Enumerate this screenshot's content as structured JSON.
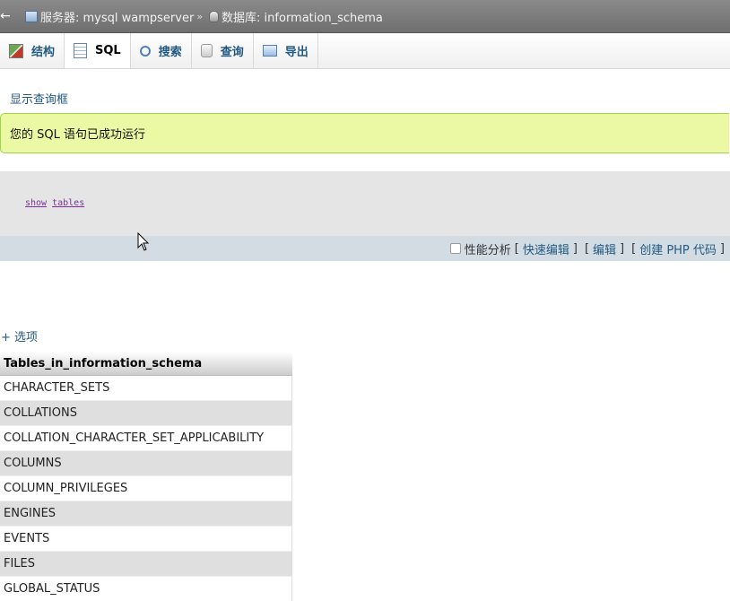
{
  "breadcrumb": {
    "back_glyph": "←",
    "server": "服务器: mysql wampserver",
    "separator": "»",
    "database": "数据库: information_schema"
  },
  "tabs": [
    {
      "label": "结构",
      "icon": "structure-icon"
    },
    {
      "label": "SQL",
      "icon": "sql-icon",
      "active": true
    },
    {
      "label": "搜索",
      "icon": "search-icon"
    },
    {
      "label": "查询",
      "icon": "query-icon"
    },
    {
      "label": "导出",
      "icon": "export-icon"
    }
  ],
  "show_query_box": "显示查询框",
  "success_message": "您的 SQL 语句已成功运行",
  "sql": {
    "keyword1": "show",
    "keyword2": "tables"
  },
  "tools": {
    "profiling": "性能分析",
    "open": "[",
    "close": "]",
    "inline_edit": "快速编辑",
    "edit": "编辑",
    "create_php": "创建 PHP 代码"
  },
  "options_link": "+ 选项",
  "results": {
    "header": "Tables_in_information_schema",
    "rows": [
      "CHARACTER_SETS",
      "COLLATIONS",
      "COLLATION_CHARACTER_SET_APPLICABILITY",
      "COLUMNS",
      "COLUMN_PRIVILEGES",
      "ENGINES",
      "EVENTS",
      "FILES",
      "GLOBAL_STATUS"
    ]
  },
  "colors": {
    "success_bg": "#ebf8a4",
    "link": "#235a81",
    "toolbar_bg": "#d3dce3"
  }
}
